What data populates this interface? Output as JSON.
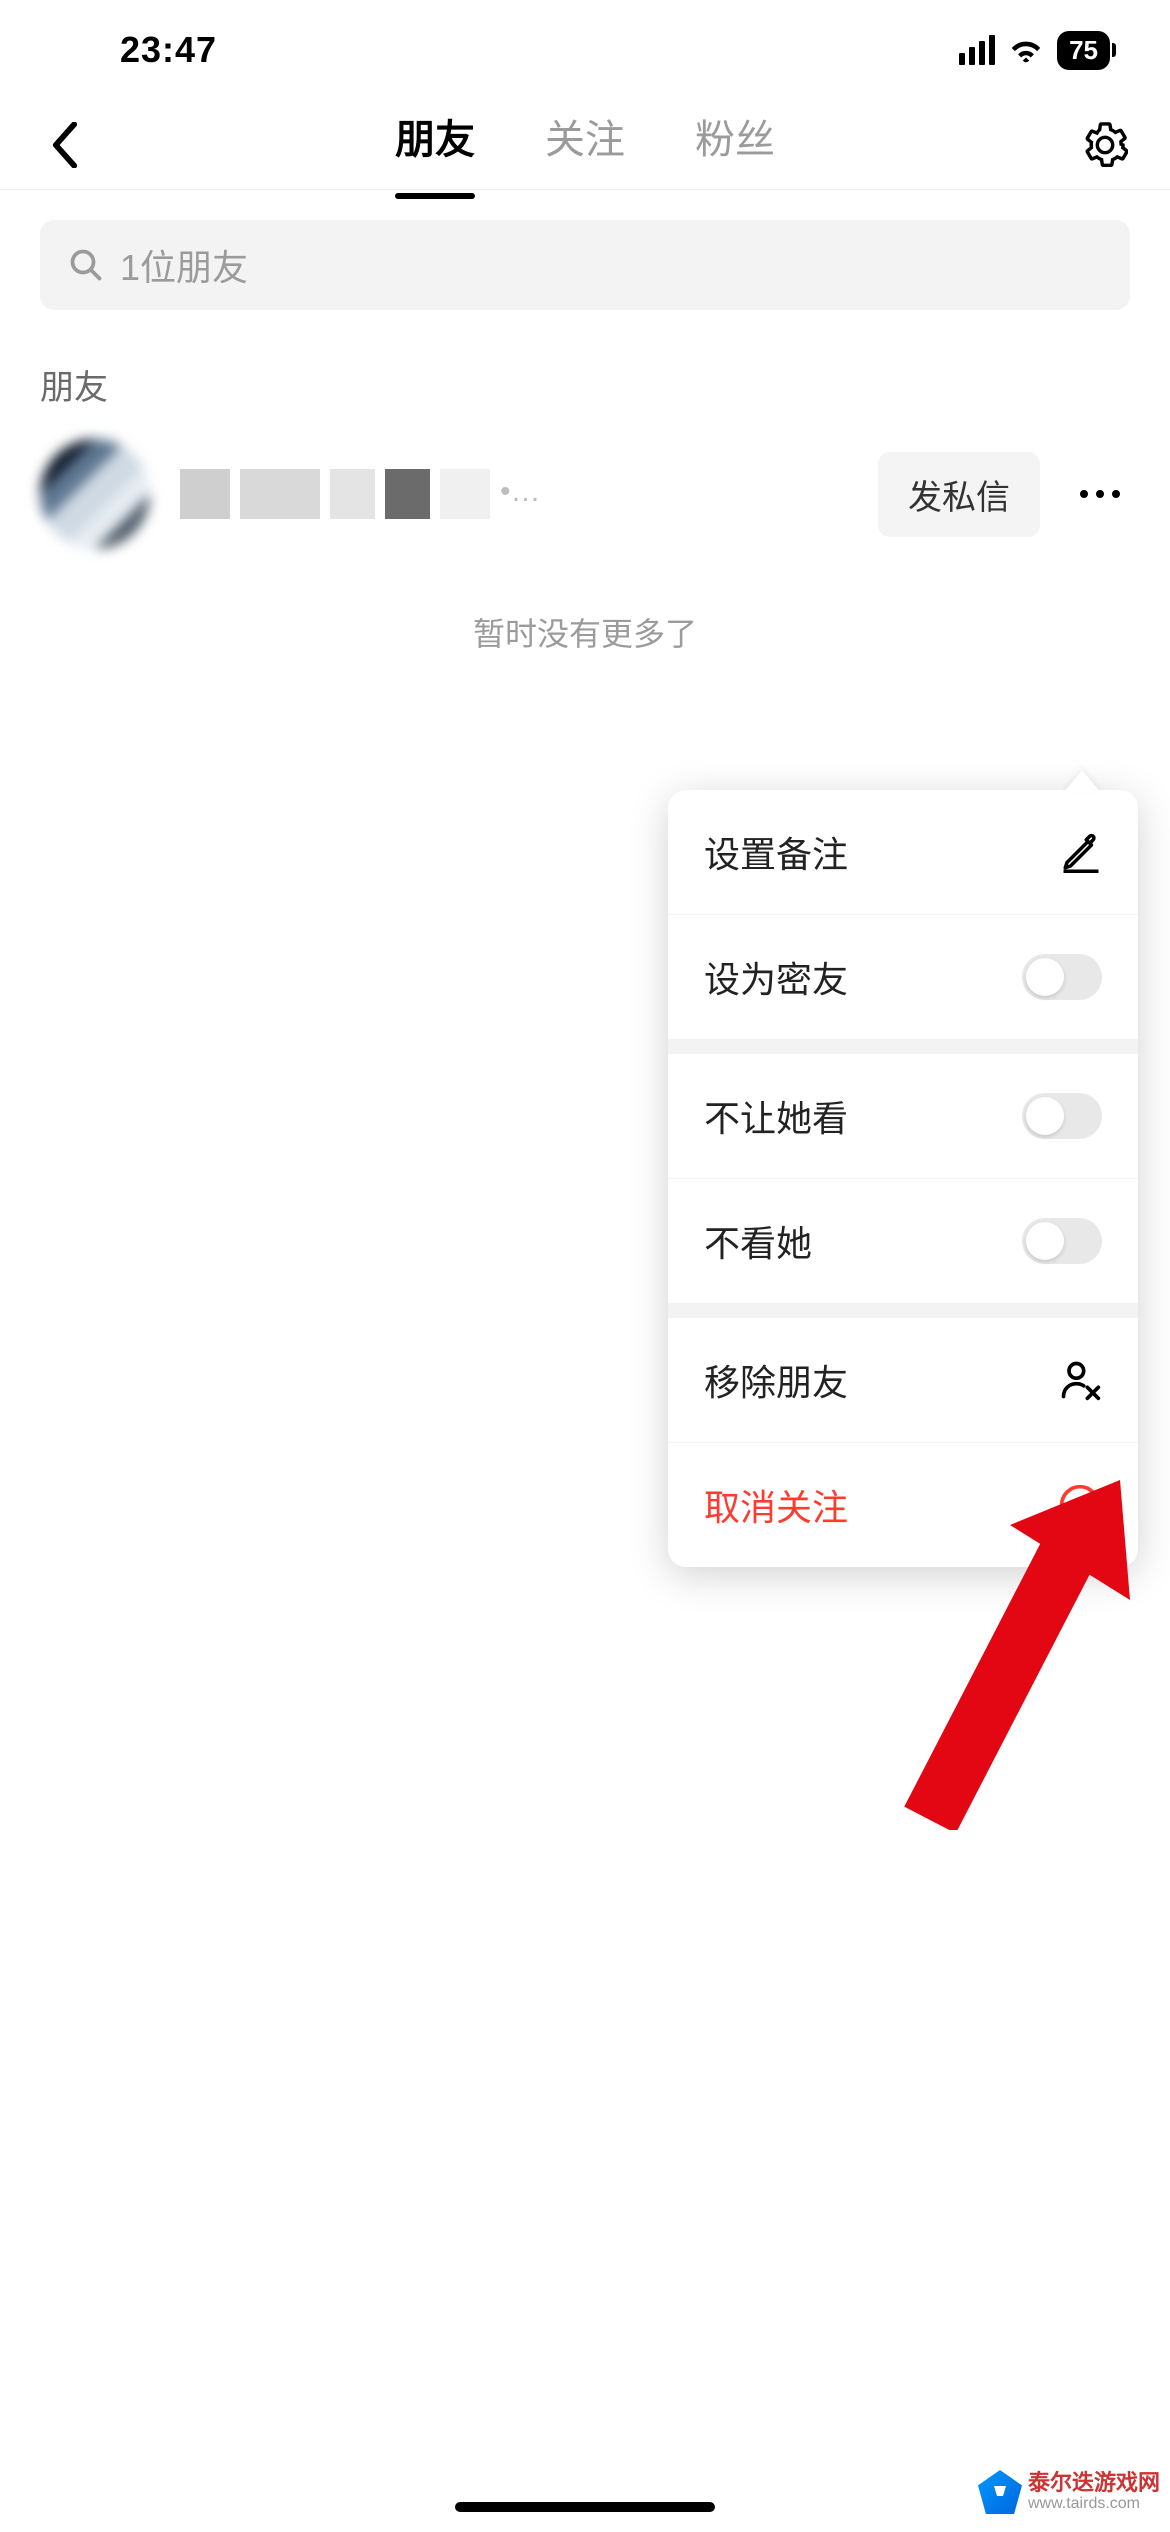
{
  "statusBar": {
    "time": "23:47",
    "battery": "75"
  },
  "header": {
    "tabs": [
      {
        "label": "朋友",
        "active": true
      },
      {
        "label": "关注",
        "active": false
      },
      {
        "label": "粉丝",
        "active": false
      }
    ]
  },
  "search": {
    "placeholder": "1位朋友"
  },
  "sectionLabel": "朋友",
  "friend": {
    "pmButton": "发私信"
  },
  "listEnd": "暂时没有更多了",
  "popup": {
    "setRemark": "设置备注",
    "setCloseFriend": "设为密友",
    "blockHerView": "不让她看",
    "dontViewHer": "不看她",
    "removeFriend": "移除朋友",
    "unfollow": "取消关注"
  },
  "watermark": {
    "title": "泰尔迭游戏网",
    "url": "www.tairds.com"
  }
}
